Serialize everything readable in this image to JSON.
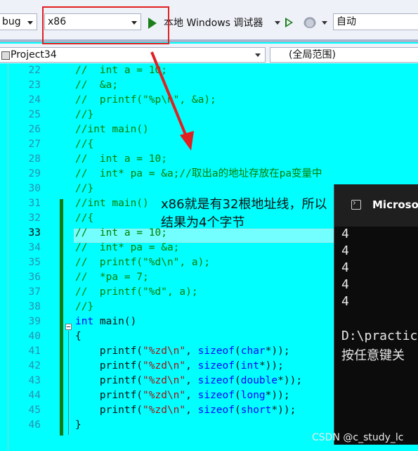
{
  "toolbar": {
    "config_value": "bug",
    "platform_value": "x86",
    "debugger_label": "本地 Windows 调试器",
    "solution_config_value": "自动"
  },
  "navbar": {
    "project_value": "Project34",
    "scope_value": "(全局范围)"
  },
  "editor": {
    "current_line": "33",
    "lines": [
      {
        "n": "22",
        "t": "//  int a = 10;"
      },
      {
        "n": "23",
        "t": "//  &a;"
      },
      {
        "n": "24",
        "t": "//  printf(\"%p\\n\", &a);"
      },
      {
        "n": "25",
        "t": "//}"
      },
      {
        "n": "26",
        "t": "//int main()"
      },
      {
        "n": "27",
        "t": "//{"
      },
      {
        "n": "28",
        "t": "//  int a = 10;"
      },
      {
        "n": "29",
        "t": "//  int* pa = &a;//取出a的地址存放在pa变量中"
      },
      {
        "n": "30",
        "t": "//}"
      },
      {
        "n": "31",
        "t": "//int main()"
      },
      {
        "n": "32",
        "t": "//{"
      },
      {
        "n": "33",
        "t": "//  int a = 10;"
      },
      {
        "n": "34",
        "t": "//  int* pa = &a;"
      },
      {
        "n": "35",
        "t": "//  printf(\"%d\\n\", a);"
      },
      {
        "n": "36",
        "t": "//  *pa = 7;"
      },
      {
        "n": "37",
        "t": "//  printf(\"%d\", a);"
      },
      {
        "n": "38",
        "t": "//}"
      },
      {
        "n": "39",
        "kw": "int",
        "t": " main()"
      },
      {
        "n": "40",
        "t": "{"
      },
      {
        "n": "41",
        "s": "\"%zd\\n\"",
        "kw": "char"
      },
      {
        "n": "42",
        "s": "\"%zd\\n\"",
        "kw": "int"
      },
      {
        "n": "43",
        "s": "\"%zd\\n\"",
        "kw": "double"
      },
      {
        "n": "44",
        "s": "\"%zd\\n\"",
        "kw": "long"
      },
      {
        "n": "45",
        "s": "\"%zd\\n\"",
        "kw": "short"
      },
      {
        "n": "46",
        "t": "}"
      }
    ]
  },
  "annotation": {
    "line1": "x86就是有32根地址线，所以",
    "line2": "结果为4个字节"
  },
  "console": {
    "title": "Microsoft",
    "output": [
      "4",
      "4",
      "4",
      "4",
      "4"
    ],
    "path_line": "D:\\practic",
    "press_key_line": "按任意键关"
  },
  "watermark": "CSDN @c_study_lc",
  "colors": {
    "editor_bg": "#00ffff",
    "comment": "#008000",
    "keyword": "#0000ff",
    "string": "#a31515",
    "line_number": "#2b91af",
    "highlight_box": "#e02020"
  }
}
